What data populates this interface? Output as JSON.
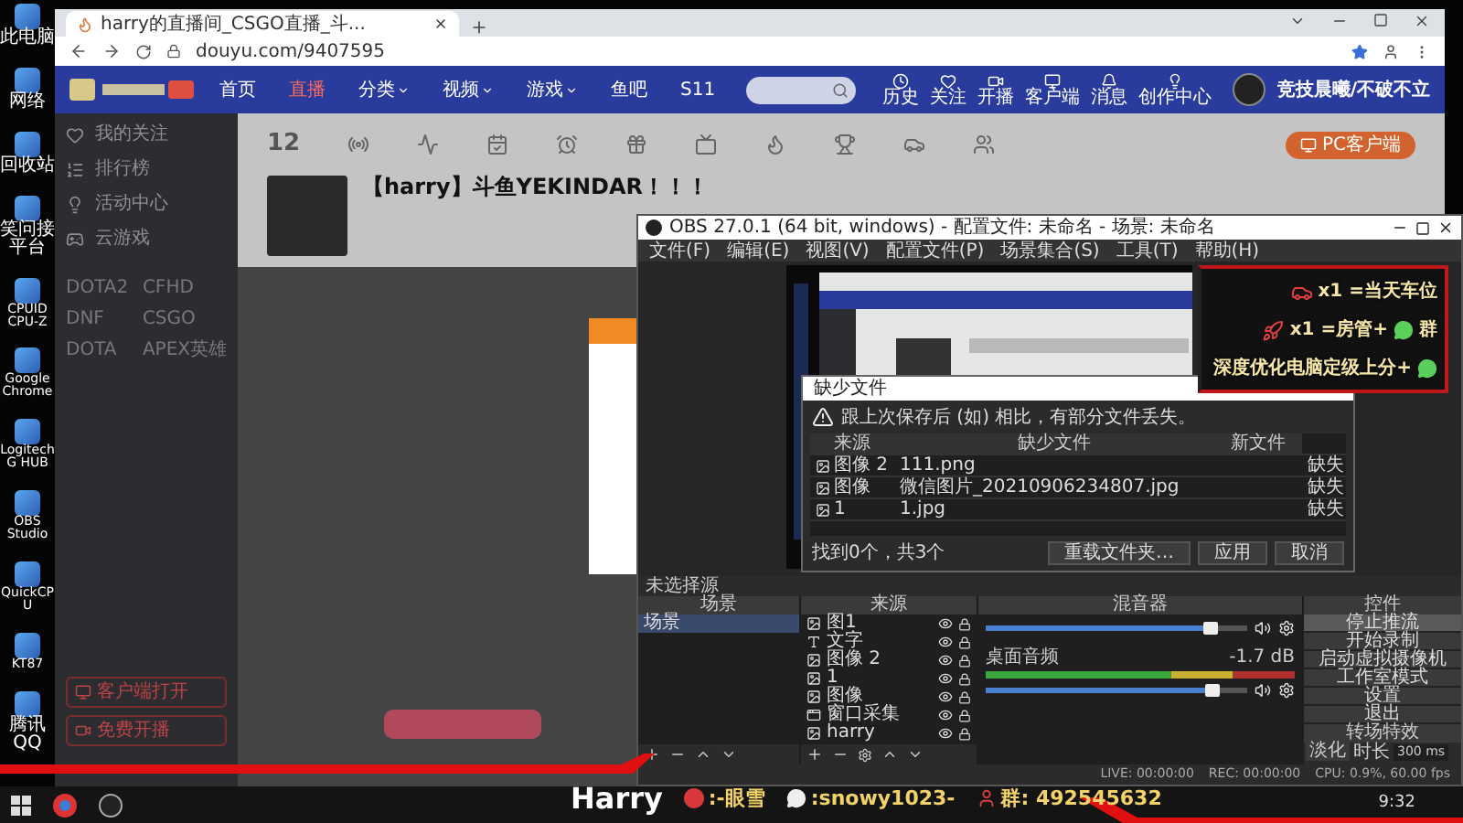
{
  "desktop_icons": [
    {
      "label": "此电脑"
    },
    {
      "label": "网络"
    },
    {
      "label": "回收站"
    },
    {
      "label": "笑问接平台"
    },
    {
      "label": "CPUID CPU-Z"
    },
    {
      "label": "Google Chrome"
    },
    {
      "label": "Logitech G HUB"
    },
    {
      "label": "OBS Studio"
    },
    {
      "label": "QuickCPU"
    },
    {
      "label": "KT87"
    },
    {
      "label": "腾讯QQ"
    }
  ],
  "browser": {
    "tab_title": "harry的直播间_CSGO直播_斗...",
    "url": "douyu.com/9407595",
    "nav": [
      {
        "label": "首页",
        "selected": false,
        "dropdown": false
      },
      {
        "label": "直播",
        "selected": true,
        "dropdown": false
      },
      {
        "label": "分类",
        "selected": false,
        "dropdown": true
      },
      {
        "label": "视频",
        "selected": false,
        "dropdown": true
      },
      {
        "label": "游戏",
        "selected": false,
        "dropdown": true
      },
      {
        "label": "鱼吧",
        "selected": false,
        "dropdown": false
      },
      {
        "label": "S11",
        "selected": false,
        "dropdown": false
      }
    ],
    "header_icons": [
      {
        "label": "历史"
      },
      {
        "label": "关注"
      },
      {
        "label": "开播"
      },
      {
        "label": "客户端"
      },
      {
        "label": "消息"
      },
      {
        "label": "创作中心"
      }
    ],
    "username": "竞技晨曦/不破不立",
    "sidebar": {
      "items": [
        {
          "label": "我的关注"
        },
        {
          "label": "排行榜"
        },
        {
          "label": "活动中心"
        },
        {
          "label": "云游戏"
        }
      ],
      "games": [
        "DOTA2",
        "CFHD",
        "DNF",
        "CSGO",
        "DOTA",
        "APEX英雄"
      ],
      "buttons": [
        "客户端打开",
        "免费开播"
      ]
    },
    "points": "12",
    "pc_client": "PC客户端",
    "room_title": "【harry】斗鱼YEKINDAR！！！"
  },
  "obs": {
    "title": "OBS 27.0.1 (64 bit, windows) - 配置文件: 未命名 - 场景: 未命名",
    "menu": [
      "文件(F)",
      "编辑(E)",
      "视图(V)",
      "配置文件(P)",
      "场景集合(S)",
      "工具(T)",
      "帮助(H)"
    ],
    "dialog": {
      "title": "缺少文件",
      "message": "跟上次保存后 (如) 相比，有部分文件丢失。",
      "columns": [
        "来源",
        "缺少文件",
        "新文件"
      ],
      "rows": [
        {
          "source": "图像 2",
          "missing": "111.png",
          "status": "缺失"
        },
        {
          "source": "图像",
          "missing": "微信图片_20210906234807.jpg",
          "status": "缺失"
        },
        {
          "source": "1",
          "missing": "1.jpg",
          "status": "缺失"
        }
      ],
      "found": "找到0个，共3个",
      "buttons": [
        "重载文件夹…",
        "应用",
        "取消"
      ]
    },
    "no_source": "未选择源",
    "scenes": {
      "header": "场景",
      "items": [
        {
          "label": "场景",
          "selected": true
        }
      ]
    },
    "sources": {
      "header": "来源",
      "items": [
        {
          "label": "图1",
          "kind": "image"
        },
        {
          "label": "文字",
          "kind": "text"
        },
        {
          "label": "图像 2",
          "kind": "image"
        },
        {
          "label": "1",
          "kind": "image"
        },
        {
          "label": "图像",
          "kind": "image"
        },
        {
          "label": "窗口采集",
          "kind": "window"
        },
        {
          "label": "harry",
          "kind": "image"
        }
      ]
    },
    "mixer": {
      "header": "混音器",
      "tracks": [
        {
          "level": 0.86
        },
        {
          "name": "桌面音频",
          "reading": "-1.7 dB",
          "level": 0.87
        }
      ]
    },
    "controls": {
      "header": "控件",
      "buttons": [
        {
          "label": "停止推流",
          "active": true
        },
        {
          "label": "开始录制",
          "active": false
        },
        {
          "label": "启动虚拟摄像机",
          "active": false
        },
        {
          "label": "工作室模式",
          "active": false
        },
        {
          "label": "设置",
          "active": false
        },
        {
          "label": "退出",
          "active": false
        }
      ]
    },
    "transition": {
      "header": "转场特效",
      "value": "淡化",
      "duration_label": "时长",
      "duration": "300 ms"
    },
    "status": [
      "LIVE: 00:00:00",
      "REC: 00:00:00",
      "CPU: 0.9%, 60.00 fps"
    ]
  },
  "overlay": [
    {
      "text": "x1 =当天车位"
    },
    {
      "text": "x1 =房管+",
      "after": "群"
    },
    {
      "text": "深度优化电脑定级上分+"
    }
  ],
  "banner": {
    "name": "Harry",
    "items": [
      {
        "text": ":-眼雪"
      },
      {
        "text": ":snowy1023-"
      },
      {
        "text": "群: 492545632"
      }
    ]
  },
  "taskbar": {
    "time": "9:32"
  }
}
